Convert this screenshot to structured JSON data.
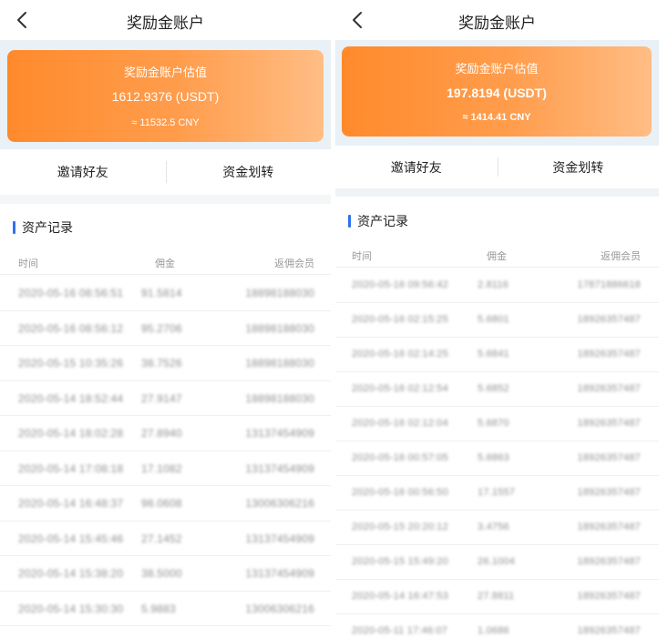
{
  "left": {
    "title": "奖励金账户",
    "card": {
      "label": "奖励金账户估值",
      "value": "1612.9376 (USDT)",
      "cny": "≈ 11532.5 CNY"
    },
    "actions": [
      "邀请好友",
      "资金划转"
    ],
    "section_title": "资产记录",
    "columns": {
      "time": "时间",
      "commission": "佣金",
      "member": "返佣会员"
    },
    "rows": [
      {
        "time": "2020-05-16 08:56:51",
        "commission": "91.5814",
        "member": "18898188030"
      },
      {
        "time": "2020-05-16 08:56:12",
        "commission": "95.2706",
        "member": "18898188030"
      },
      {
        "time": "2020-05-15 10:35:26",
        "commission": "38.7526",
        "member": "18898188030"
      },
      {
        "time": "2020-05-14 18:52:44",
        "commission": "27.9147",
        "member": "18898188030"
      },
      {
        "time": "2020-05-14 18:02:28",
        "commission": "27.8940",
        "member": "13137454909"
      },
      {
        "time": "2020-05-14 17:08:18",
        "commission": "17.1082",
        "member": "13137454909"
      },
      {
        "time": "2020-05-14 16:48:37",
        "commission": "98.0608",
        "member": "13006306216"
      },
      {
        "time": "2020-05-14 15:45:46",
        "commission": "27.1452",
        "member": "13137454909"
      },
      {
        "time": "2020-05-14 15:38:20",
        "commission": "38.5000",
        "member": "13137454909"
      },
      {
        "time": "2020-05-14 15:30:30",
        "commission": "5.9883",
        "member": "13006306216"
      }
    ]
  },
  "right": {
    "title": "奖励金账户",
    "card": {
      "label": "奖励金账户估值",
      "value": "197.8194 (USDT)",
      "cny": "≈ 1414.41 CNY"
    },
    "actions": [
      "邀请好友",
      "资金划转"
    ],
    "section_title": "资产记录",
    "columns": {
      "time": "时间",
      "commission": "佣金",
      "member": "返佣会员"
    },
    "rows": [
      {
        "time": "2020-05-16 09:56:42",
        "commission": "2.8116",
        "member": "17871886618"
      },
      {
        "time": "2020-05-16 02:15:25",
        "commission": "5.6801",
        "member": "18926357487"
      },
      {
        "time": "2020-05-16 02:14:25",
        "commission": "5.6841",
        "member": "18926357487"
      },
      {
        "time": "2020-05-16 02:12:54",
        "commission": "5.6852",
        "member": "18926357487"
      },
      {
        "time": "2020-05-16 02:12:04",
        "commission": "5.6870",
        "member": "18926357487"
      },
      {
        "time": "2020-05-16 00:57:05",
        "commission": "5.6863",
        "member": "18926357487"
      },
      {
        "time": "2020-05-16 00:56:50",
        "commission": "17.1557",
        "member": "18926357487"
      },
      {
        "time": "2020-05-15 20:20:12",
        "commission": "3.4756",
        "member": "18926357487"
      },
      {
        "time": "2020-05-15 15:49:20",
        "commission": "26.1004",
        "member": "18926357487"
      },
      {
        "time": "2020-05-14 16:47:53",
        "commission": "27.8811",
        "member": "18926357487"
      },
      {
        "time": "2020-05-11 17:46:07",
        "commission": "1.0686",
        "member": "18926357487"
      }
    ]
  }
}
